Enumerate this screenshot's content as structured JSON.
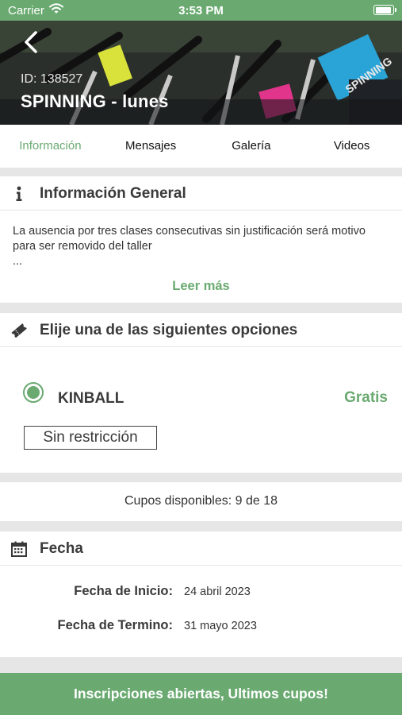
{
  "status_bar": {
    "carrier": "Carrier",
    "time": "3:53 PM"
  },
  "header": {
    "id_label": "ID: 138527",
    "title": "SPINNING - lunes",
    "image_text": "SPINNING"
  },
  "tabs": [
    {
      "label": "Información",
      "active": true
    },
    {
      "label": "Mensajes",
      "active": false
    },
    {
      "label": "Galería",
      "active": false
    },
    {
      "label": "Videos",
      "active": false
    }
  ],
  "info_section": {
    "icon": "info-icon",
    "title": "Información General",
    "body": "La ausencia por tres clases consecutivas sin justificación será motivo para ser removido del taller",
    "ellipsis": "...",
    "read_more": "Leer más"
  },
  "options_section": {
    "icon": "ticket-icon",
    "title": "Elije una de las siguientes opciones",
    "option": {
      "name": "KINBALL",
      "price": "Gratis",
      "restriction": "Sin restricción",
      "selected": true
    }
  },
  "availability": {
    "text": "Cupos disponibles: 9 de 18"
  },
  "date_section": {
    "icon": "calendar-icon",
    "title": "Fecha",
    "start_label": "Fecha de Inicio:",
    "start_value": "24 abril 2023",
    "end_label": "Fecha de Termino:",
    "end_value": "31 mayo 2023"
  },
  "footer": {
    "button_label": "Inscripciones abiertas, Ultimos cupos!"
  },
  "colors": {
    "accent": "#6aaa71",
    "background": "#e6e6e6"
  }
}
